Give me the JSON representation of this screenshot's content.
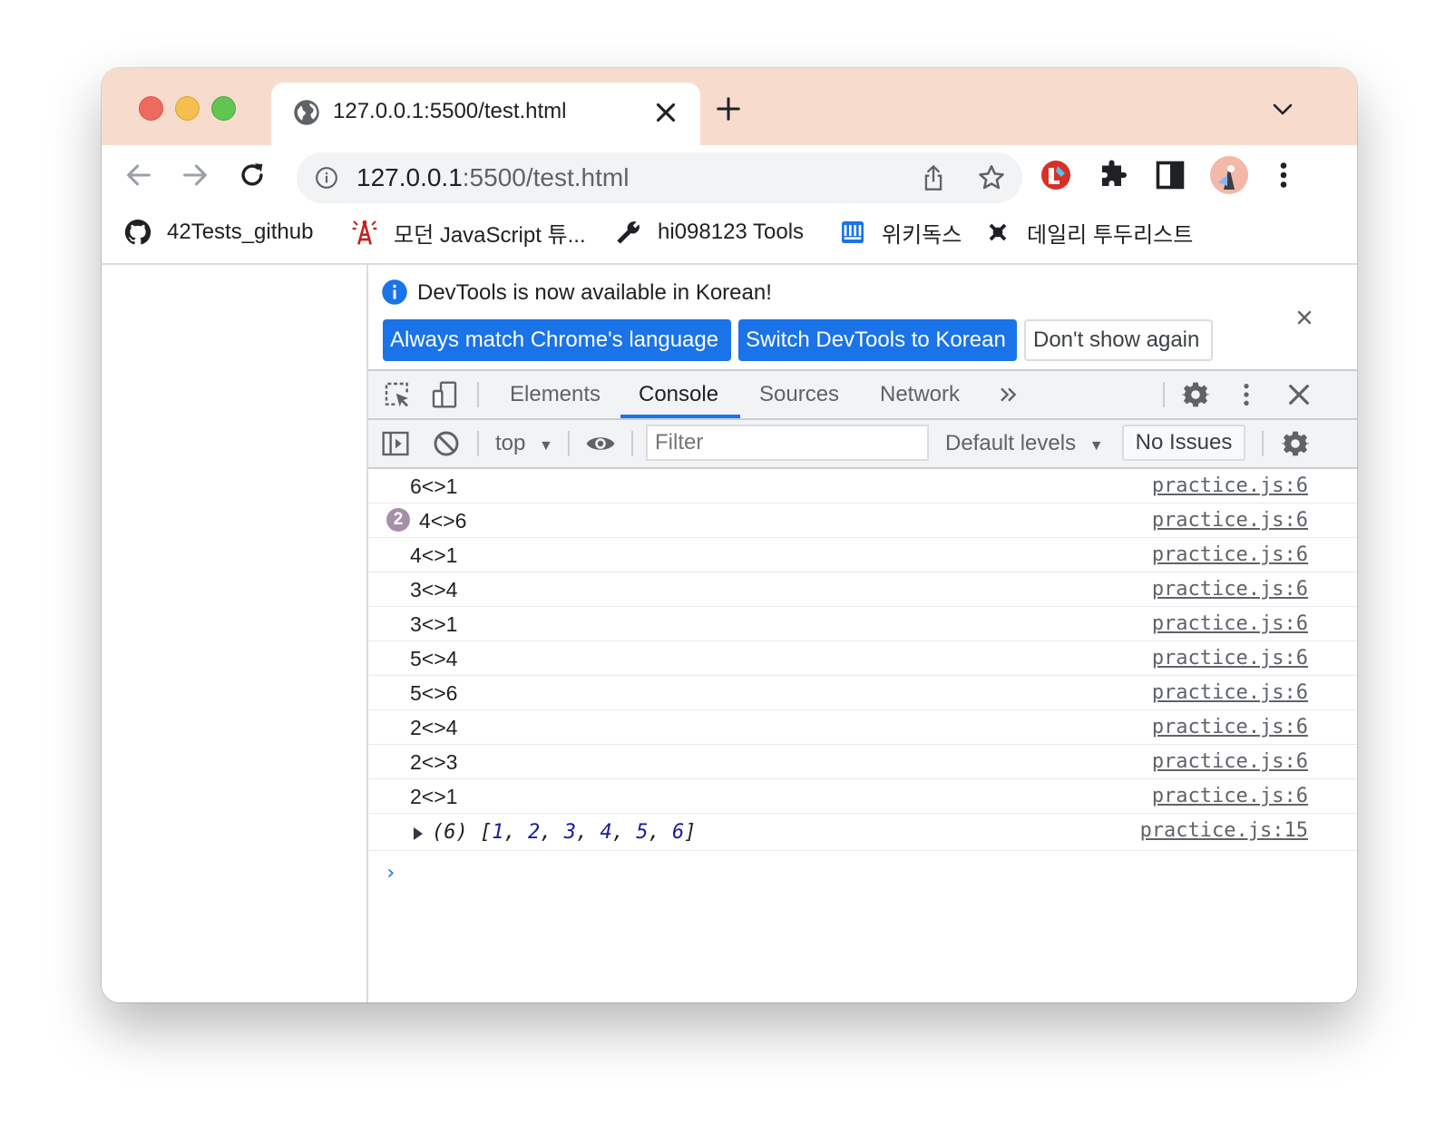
{
  "browser": {
    "tab_title": "127.0.0.1:5500/test.html",
    "url_host": "127.0.0.1",
    "url_path": ":5500/test.html",
    "bookmarks": [
      {
        "label": "42Tests_github",
        "icon": "github-icon"
      },
      {
        "label": "모던 JavaScript 튜...",
        "icon": "tower-icon"
      },
      {
        "label": "hi098123 Tools",
        "icon": "wrench-icon"
      },
      {
        "label": "위키독스",
        "icon": "wikidocs-icon"
      },
      {
        "label": "데일리 투두리스트",
        "icon": "todo-icon"
      }
    ]
  },
  "devtools": {
    "infobar": {
      "message": "DevTools is now available in Korean!",
      "btn_match": "Always match Chrome's language",
      "btn_switch": "Switch DevTools to Korean",
      "btn_dont_show": "Don't show again"
    },
    "tabs": [
      "Elements",
      "Console",
      "Sources",
      "Network"
    ],
    "active_tab": "Console",
    "console_toolbar": {
      "context": "top",
      "filter_placeholder": "Filter",
      "levels": "Default levels",
      "issues": "No Issues"
    },
    "messages": [
      {
        "text": "6<>1",
        "source": "practice.js:6",
        "count": ""
      },
      {
        "text": "4<>6",
        "source": "practice.js:6",
        "count": "2"
      },
      {
        "text": "4<>1",
        "source": "practice.js:6",
        "count": ""
      },
      {
        "text": "3<>4",
        "source": "practice.js:6",
        "count": ""
      },
      {
        "text": "3<>1",
        "source": "practice.js:6",
        "count": ""
      },
      {
        "text": "5<>4",
        "source": "practice.js:6",
        "count": ""
      },
      {
        "text": "5<>6",
        "source": "practice.js:6",
        "count": ""
      },
      {
        "text": "2<>4",
        "source": "practice.js:6",
        "count": ""
      },
      {
        "text": "2<>3",
        "source": "practice.js:6",
        "count": ""
      },
      {
        "text": "2<>1",
        "source": "practice.js:6",
        "count": ""
      }
    ],
    "array_log": {
      "length_label": "(6)",
      "values": [
        "1",
        "2",
        "3",
        "4",
        "5",
        "6"
      ],
      "source": "practice.js:15"
    },
    "prompt": "›"
  }
}
